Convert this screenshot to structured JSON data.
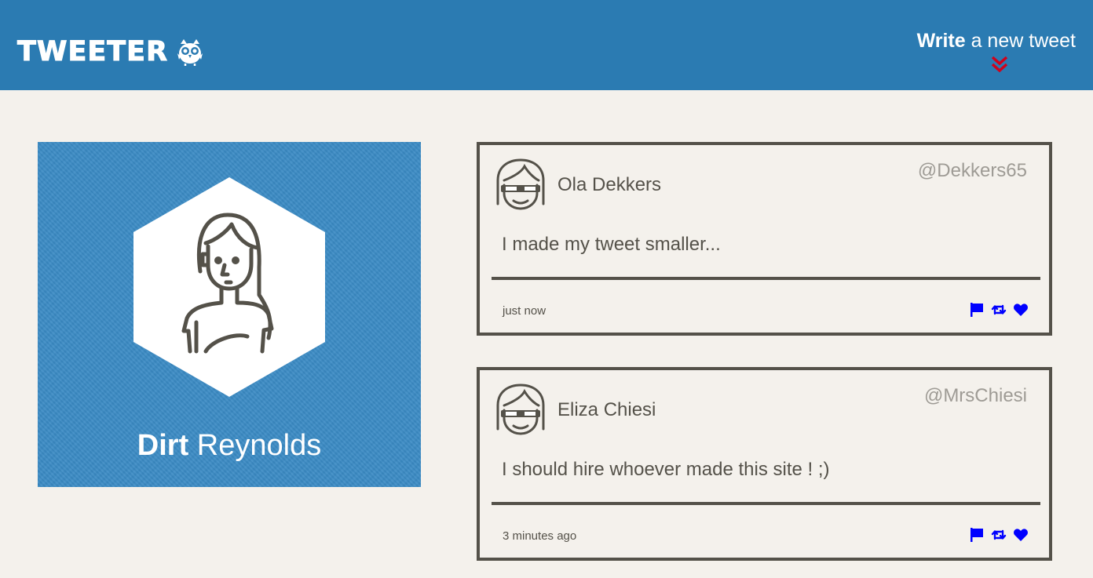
{
  "nav": {
    "logo_text": "TWEETER",
    "compose_bold": "Write",
    "compose_rest": " a new tweet",
    "arrow_color": "#d0021b"
  },
  "profile": {
    "first_name": "Dirt",
    "last_name": " Reynolds",
    "background_color": "#3a8ac4"
  },
  "tweets": [
    {
      "name": "Ola Dekkers",
      "handle": "@Dekkers65",
      "text": "I made my tweet smaller...",
      "time": "just now"
    },
    {
      "name": "Eliza Chiesi",
      "handle": "@MrsChiesi",
      "text": "I should hire whoever made this site ! ;)",
      "time": "3 minutes ago"
    }
  ],
  "colors": {
    "nav_bg": "#2b7bb2",
    "page_bg": "#f4f1ec",
    "text": "#545149",
    "handle": "#9e9b95",
    "action_icons": "#0000ff"
  },
  "icons": [
    "bird-icon",
    "double-chevron-down-icon",
    "flag-icon",
    "retweet-icon",
    "heart-icon"
  ]
}
